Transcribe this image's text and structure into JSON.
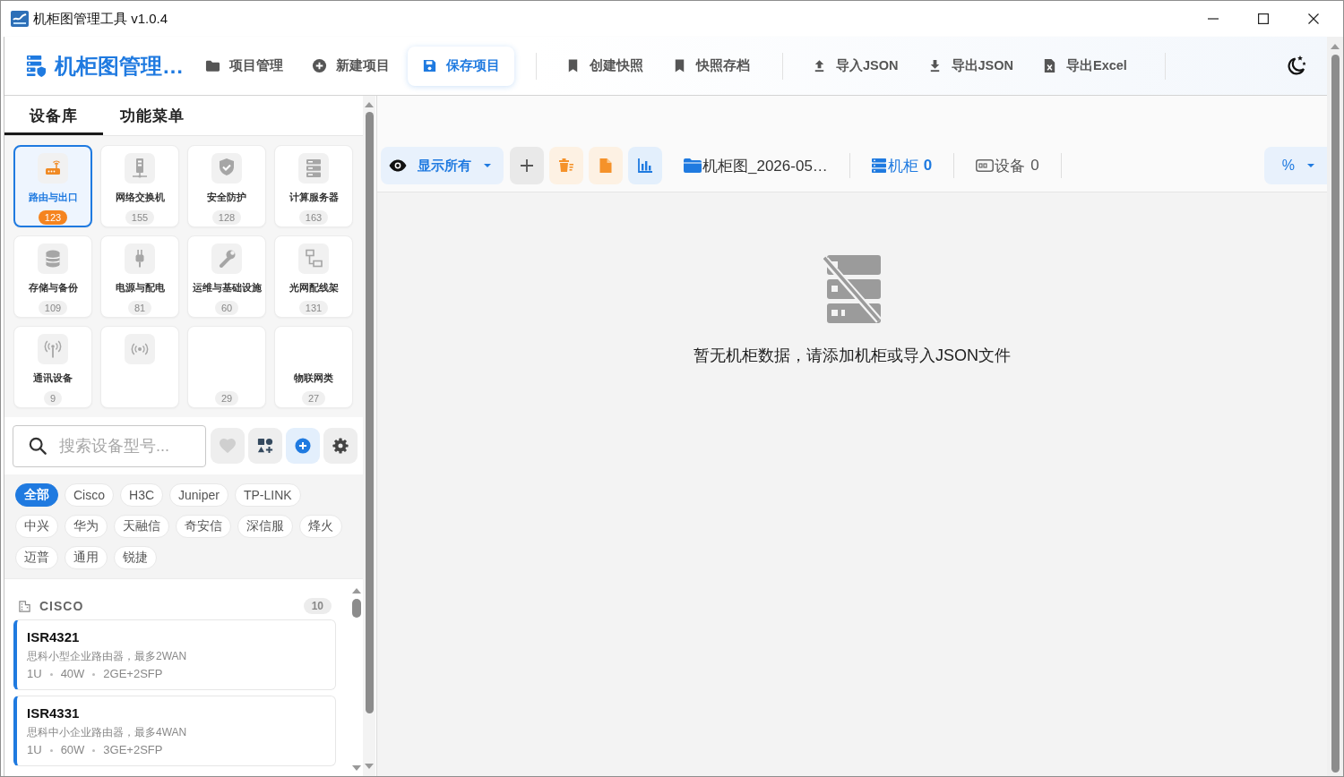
{
  "window": {
    "title": "机柜图管理工具 v1.0.4"
  },
  "header": {
    "app_name": "机柜图管理…",
    "button_groups": [
      [
        {
          "kind": "folder",
          "label": "项目管理",
          "selected": false
        },
        {
          "kind": "new",
          "label": "新建项目",
          "selected": false
        },
        {
          "kind": "save",
          "label": "保存项目",
          "selected": true
        }
      ],
      [
        {
          "kind": "bookmark",
          "label": "创建快照",
          "selected": false
        },
        {
          "kind": "bookmark",
          "label": "快照存档",
          "selected": false
        }
      ],
      [
        {
          "kind": "import",
          "label": "导入JSON",
          "selected": false
        },
        {
          "kind": "export",
          "label": "导出JSON",
          "selected": false
        },
        {
          "kind": "excel",
          "label": "导出Excel",
          "selected": false
        }
      ]
    ]
  },
  "sidebar": {
    "tabs": [
      {
        "label": "设备库",
        "selected": true
      },
      {
        "label": "功能菜单",
        "selected": false
      }
    ],
    "categories": [
      {
        "kind": "router",
        "name": "路由与出口",
        "count": "123",
        "selected": true
      },
      {
        "kind": "switch",
        "name": "网络交换机",
        "count": "155",
        "selected": false
      },
      {
        "kind": "security",
        "name": "安全防护",
        "count": "128",
        "selected": false
      },
      {
        "kind": "server",
        "name": "计算服务器",
        "count": "163",
        "selected": false
      },
      {
        "kind": "storage",
        "name": "存储与备份",
        "count": "109",
        "selected": false
      },
      {
        "kind": "power",
        "name": "电源与配电",
        "count": "81",
        "selected": false
      },
      {
        "kind": "tools",
        "name": "运维与基础设施",
        "count": "60",
        "selected": false
      },
      {
        "kind": "cabling",
        "name": "光网配线架",
        "count": "131",
        "selected": false
      },
      {
        "kind": "antenna",
        "name": "通讯设备",
        "count": "9",
        "selected": false
      },
      {
        "kind": "wireless",
        "selected": false
      },
      {
        "count": "29",
        "selected": false
      },
      {
        "name": "物联网类",
        "count": "27",
        "selected": false
      }
    ],
    "search": {
      "placeholder": "搜索设备型号..."
    },
    "brands": [
      {
        "label": "全部",
        "selected": true
      },
      {
        "label": "Cisco",
        "selected": false
      },
      {
        "label": "H3C",
        "selected": false
      },
      {
        "label": "Juniper",
        "selected": false
      },
      {
        "label": "TP-LINK",
        "selected": false
      },
      {
        "label": "中兴",
        "selected": false
      },
      {
        "label": "华为",
        "selected": false
      },
      {
        "label": "天融信",
        "selected": false
      },
      {
        "label": "奇安信",
        "selected": false
      },
      {
        "label": "深信服",
        "selected": false
      },
      {
        "label": "烽火",
        "selected": false
      },
      {
        "label": "迈普",
        "selected": false
      },
      {
        "label": "通用",
        "selected": false
      },
      {
        "label": "锐捷",
        "selected": false
      }
    ],
    "device_groups": [
      {
        "name": "CISCO",
        "count": "10",
        "devices": [
          {
            "model": "ISR4321",
            "description": "思科小型企业路由器，最多2WAN",
            "specs": [
              "1U",
              "40W",
              "2GE+2SFP"
            ]
          },
          {
            "model": "ISR4331",
            "description": "思科中小企业路由器，最多4WAN",
            "specs": [
              "1U",
              "60W",
              "3GE+2SFP"
            ]
          }
        ]
      }
    ]
  },
  "main": {
    "toolbar": {
      "view_filter": "显示所有",
      "file_name": "机柜图_2026-05…",
      "racks_label": "机柜",
      "racks_count": "0",
      "devices_label": "设备",
      "devices_count": "0",
      "zoom": "%"
    },
    "empty_message": "暂无机柜数据，请添加机柜或导入JSON文件"
  }
}
